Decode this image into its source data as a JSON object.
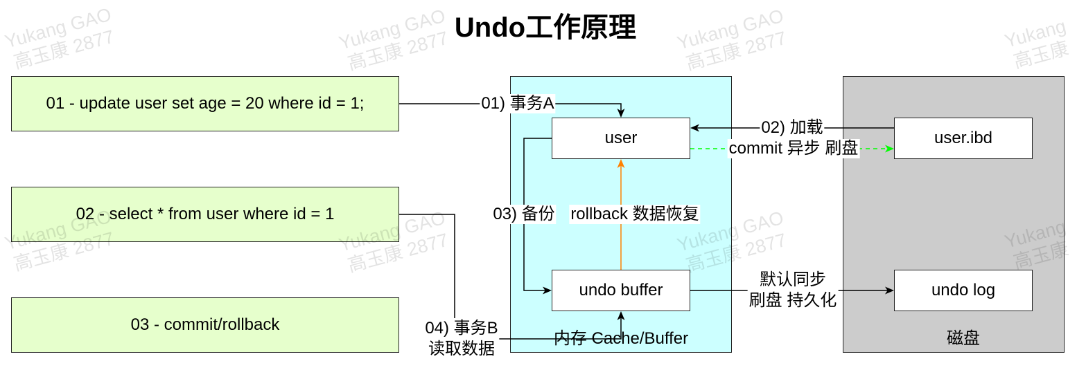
{
  "title": "Undo工作原理",
  "statements": [
    {
      "text": "01 - update user set age = 20 where id = 1;"
    },
    {
      "text": "02 - select * from user where id = 1"
    },
    {
      "text": "03 - commit/rollback"
    }
  ],
  "memory": {
    "label": "内存 Cache/Buffer",
    "nodes": {
      "user": "user",
      "undo_buffer": "undo buffer"
    }
  },
  "disk": {
    "label": "磁盘",
    "nodes": {
      "user_ibd": "user.ibd",
      "undo_log": "undo log"
    }
  },
  "edges": {
    "txn_a": "01) 事务A",
    "load": "02) 加载",
    "commit_flush": "commit 异步 刷盘",
    "backup": "03) 备份",
    "rollback": "rollback 数据恢复",
    "sync_flush": [
      "默认同步",
      "刷盘 持久化"
    ],
    "txn_b_read": [
      "04) 事务B",
      "读取数据"
    ]
  },
  "colors": {
    "statement_fill": "#e6ffcc",
    "memory_fill": "#ccffff",
    "disk_fill": "#cccccc",
    "commit_flush_line": "#00ff00",
    "rollback_line": "#ff8000"
  },
  "watermark": {
    "line1": "Yukang GAO",
    "line2": "高玉康 2877"
  },
  "watermark_edge": {
    "line1": "Yukang",
    "line2": "高玉康"
  }
}
